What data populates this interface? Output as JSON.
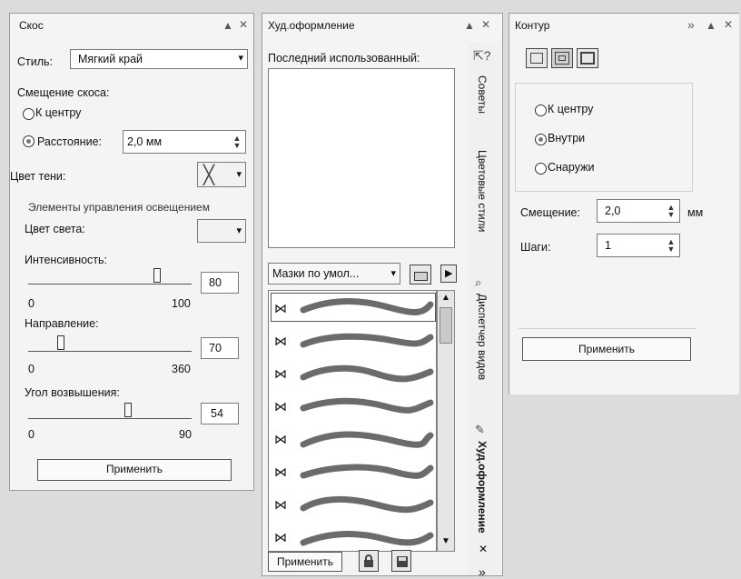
{
  "bevel": {
    "title": "Скос",
    "style_label": "Стиль:",
    "style_value": "Мягкий край",
    "offset_label": "Смещение скоса:",
    "to_center": "К центру",
    "distance": "Расстояние:",
    "distance_value": "2,0 мм",
    "shadow_color": "Цвет тени:",
    "lighting_group": "Элементы управления освещением",
    "light_color": "Цвет света:",
    "intensity_label": "Интенсивность:",
    "intensity_value": "80",
    "intensity_min": "0",
    "intensity_max": "100",
    "intensity_level": 0.8,
    "direction_label": "Направление:",
    "direction_value": "70",
    "direction_min": "0",
    "direction_max": "360",
    "direction_level": 0.19,
    "elevation_label": "Угол возвышения:",
    "elevation_value": "54",
    "elevation_min": "0",
    "elevation_max": "90",
    "elevation_level": 0.6,
    "apply": "Применить"
  },
  "artistic": {
    "title": "Худ.оформление",
    "last_used": "Последний использованный:",
    "preset_dropdown": "Мазки по умол...",
    "apply": "Применить"
  },
  "side_tabs": {
    "hints": "Советы",
    "color_styles": "Цветовые стили",
    "view_manager": "Диспетчер видов",
    "artistic_media": "Худ.оформление"
  },
  "contour": {
    "title": "Контур",
    "to_center": "К центру",
    "inside": "Внутри",
    "outside": "Снаружи",
    "offset_label": "Смещение:",
    "offset_value": "2,0",
    "offset_unit": "мм",
    "steps_label": "Шаги:",
    "steps_value": "1",
    "apply": "Применить"
  },
  "stroke_color": "#6b6b6b",
  "icons": {
    "pin": "▲",
    "close": "✕",
    "more": "»",
    "dropdown": "▾",
    "bowtie": "⋈"
  }
}
